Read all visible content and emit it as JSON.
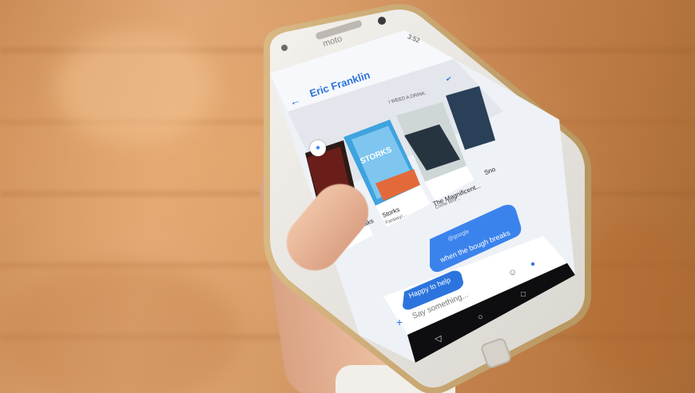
{
  "status_bar": {
    "time": "3:52"
  },
  "phone_brand": "moto",
  "chat": {
    "contact_name": "Eric Franklin",
    "peek_caption": "I WEED A DRINK.",
    "cards": [
      {
        "title": "the Bough Breaks",
        "subtitle": ""
      },
      {
        "title": "Storks",
        "subtitle": "Fantasy/..."
      },
      {
        "title": "The Magnificent...",
        "subtitle": "Crime film/..."
      },
      {
        "title": "Sno",
        "subtitle": ""
      }
    ],
    "poster_text": "STORKS",
    "bubble_mention": "@google",
    "bubble_text": "when the bough breaks",
    "reply_text": "Happy to help",
    "input_placeholder": "Say something..."
  },
  "colors": {
    "accent": "#2c74dd",
    "bubble": "#3b83ec",
    "screen_bg": "#eef1f6",
    "phone_body": "#e9e7e3"
  }
}
